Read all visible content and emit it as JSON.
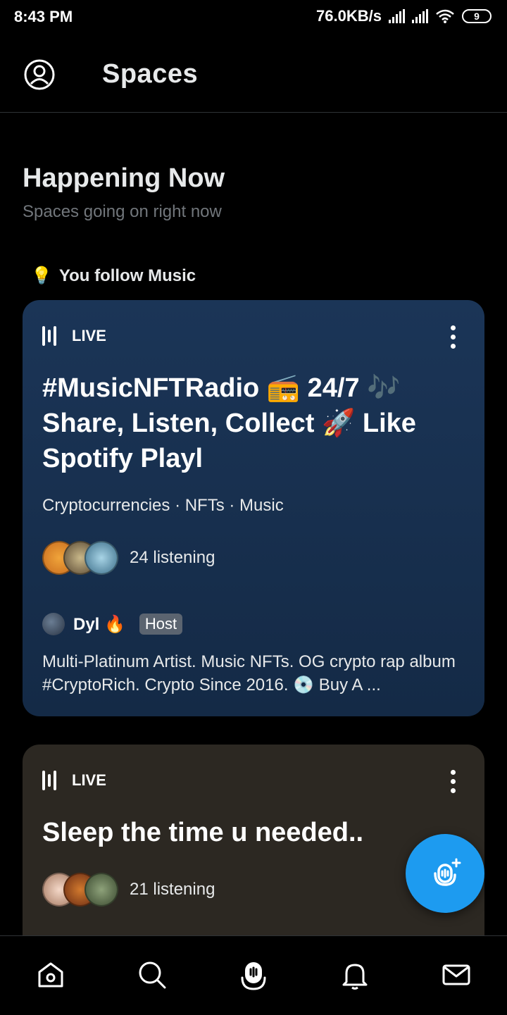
{
  "status_bar": {
    "time": "8:43 PM",
    "network_speed": "76.0KB/s",
    "battery": "9"
  },
  "header": {
    "title": "Spaces"
  },
  "section": {
    "title": "Happening Now",
    "subtitle": "Spaces going on right now"
  },
  "follow_hint": {
    "emoji": "💡",
    "label": "You follow Music"
  },
  "spaces": [
    {
      "live_label": "LIVE",
      "title": "#MusicNFTRadio 📻 24/7 🎶 Share, Listen, Collect 🚀 Like Spotify Playl",
      "topics": "Cryptocurrencies · NFTs · Music",
      "listeners": "24 listening",
      "host": {
        "name": "Dyl 🔥",
        "badge": "Host",
        "bio": "Multi-Platinum Artist. Music NFTs. OG crypto rap album #CryptoRich. Crypto Since 2016. 💿 Buy A ..."
      }
    },
    {
      "live_label": "LIVE",
      "title": "Sleep the time u needed..",
      "listeners": "21 listening"
    }
  ],
  "colors": {
    "accent": "#1d9bf0",
    "card1_bg": "#1b3557",
    "card2_bg": "#2c2822",
    "muted_text": "#71767b"
  },
  "nav": {
    "icons": [
      "home-icon",
      "search-icon",
      "spaces-icon",
      "notifications-icon",
      "messages-icon"
    ]
  }
}
